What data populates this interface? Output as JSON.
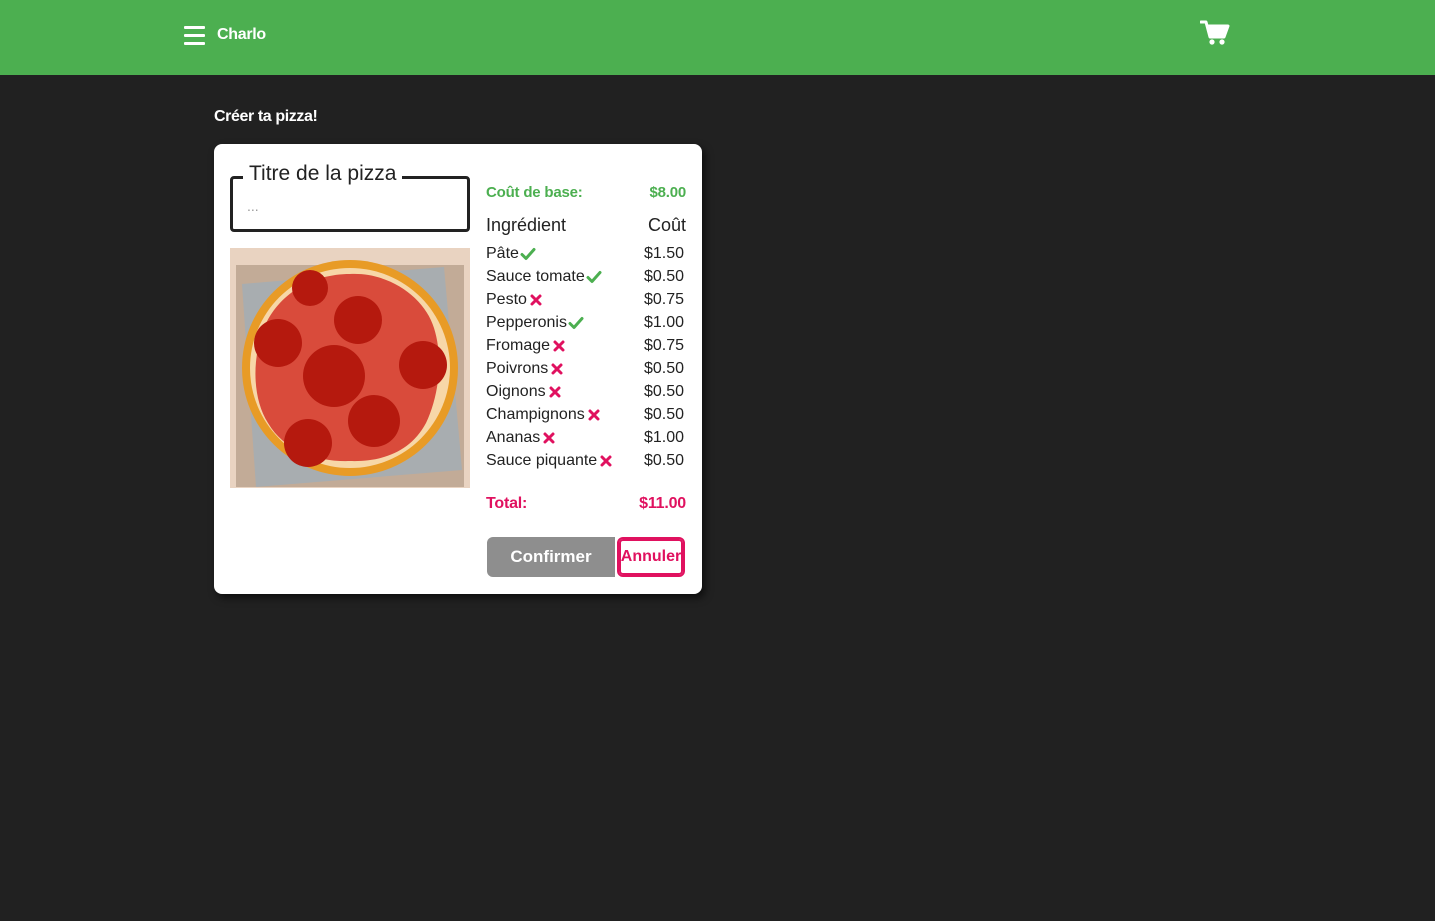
{
  "header": {
    "brand": "Charlo",
    "menu_icon": "hamburger-menu-icon",
    "cart_icon": "shopping-cart-icon",
    "background": "#4caf50"
  },
  "page": {
    "title": "Créer ta pizza!"
  },
  "form": {
    "title_label": "Titre de la pizza",
    "title_placeholder": "...",
    "title_value": ""
  },
  "pricing": {
    "base_label": "Coût de base:",
    "base_value": "$8.00",
    "ingredient_header": "Ingrédient",
    "cost_header": "Coût",
    "ingredients": [
      {
        "name": "Pâte",
        "selected": true,
        "price": "$1.50"
      },
      {
        "name": "Sauce tomate",
        "selected": true,
        "price": "$0.50"
      },
      {
        "name": "Pesto",
        "selected": false,
        "price": "$0.75"
      },
      {
        "name": "Pepperonis",
        "selected": true,
        "price": "$1.00"
      },
      {
        "name": "Fromage",
        "selected": false,
        "price": "$0.75"
      },
      {
        "name": "Poivrons",
        "selected": false,
        "price": "$0.50"
      },
      {
        "name": "Oignons",
        "selected": false,
        "price": "$0.50"
      },
      {
        "name": "Champignons",
        "selected": false,
        "price": "$0.50"
      },
      {
        "name": "Ananas",
        "selected": false,
        "price": "$1.00"
      },
      {
        "name": "Sauce piquante",
        "selected": false,
        "price": "$0.50"
      }
    ],
    "total_label": "Total:",
    "total_value": "$11.00"
  },
  "actions": {
    "confirm_label": "Confirmer",
    "cancel_label": "Annuler"
  },
  "colors": {
    "accent_green": "#4caf50",
    "accent_pink": "#e0115f",
    "background": "#212121"
  }
}
